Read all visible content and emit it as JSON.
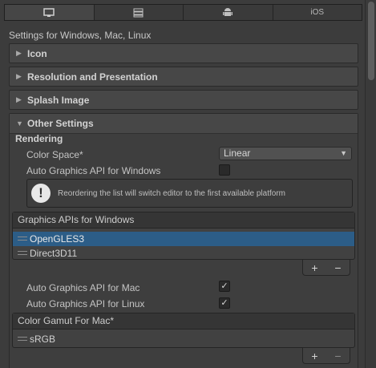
{
  "tabs": [
    {
      "icon": "monitor-icon",
      "label": ""
    },
    {
      "icon": "server-icon",
      "label": ""
    },
    {
      "icon": "android-icon",
      "label": ""
    },
    {
      "icon": "",
      "label": "iOS"
    }
  ],
  "subtitle": "Settings for Windows, Mac, Linux",
  "sections": {
    "icon": "Icon",
    "resolution": "Resolution and Presentation",
    "splash": "Splash Image",
    "other": "Other Settings"
  },
  "rendering": {
    "heading": "Rendering",
    "color_space_label": "Color Space*",
    "color_space_value": "Linear",
    "auto_api_windows_label": "Auto Graphics API  for Windows",
    "auto_api_windows_checked": false,
    "help_message": "Reordering the list will switch editor to the first available platform",
    "graphics_list": {
      "header": "Graphics APIs for Windows",
      "items": [
        "OpenGLES3",
        "Direct3D11"
      ],
      "selected_index": 0
    },
    "auto_api_mac_label": "Auto Graphics API  for Mac",
    "auto_api_mac_checked": true,
    "auto_api_linux_label": "Auto Graphics API  for Linux",
    "auto_api_linux_checked": true,
    "gamut_list": {
      "header": "Color Gamut For Mac*",
      "items": [
        "sRGB"
      ]
    },
    "add_label": "+",
    "remove_label": "−"
  }
}
